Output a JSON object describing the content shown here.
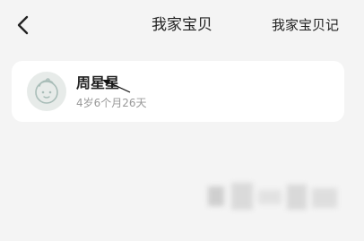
{
  "header": {
    "title": "我家宝贝",
    "diary_link": "我家宝贝记"
  },
  "baby": {
    "name": "周星星",
    "age": "4岁6个月26天"
  },
  "icons": {
    "back": "chevron-left-icon",
    "avatar": "baby-face-avatar",
    "cursor": "arrow-cursor-icon"
  },
  "colors": {
    "background": "#f4f4f4",
    "card": "#ffffff",
    "avatar_bg": "#e7ebe9",
    "avatar_stroke": "#a9bdb8"
  }
}
